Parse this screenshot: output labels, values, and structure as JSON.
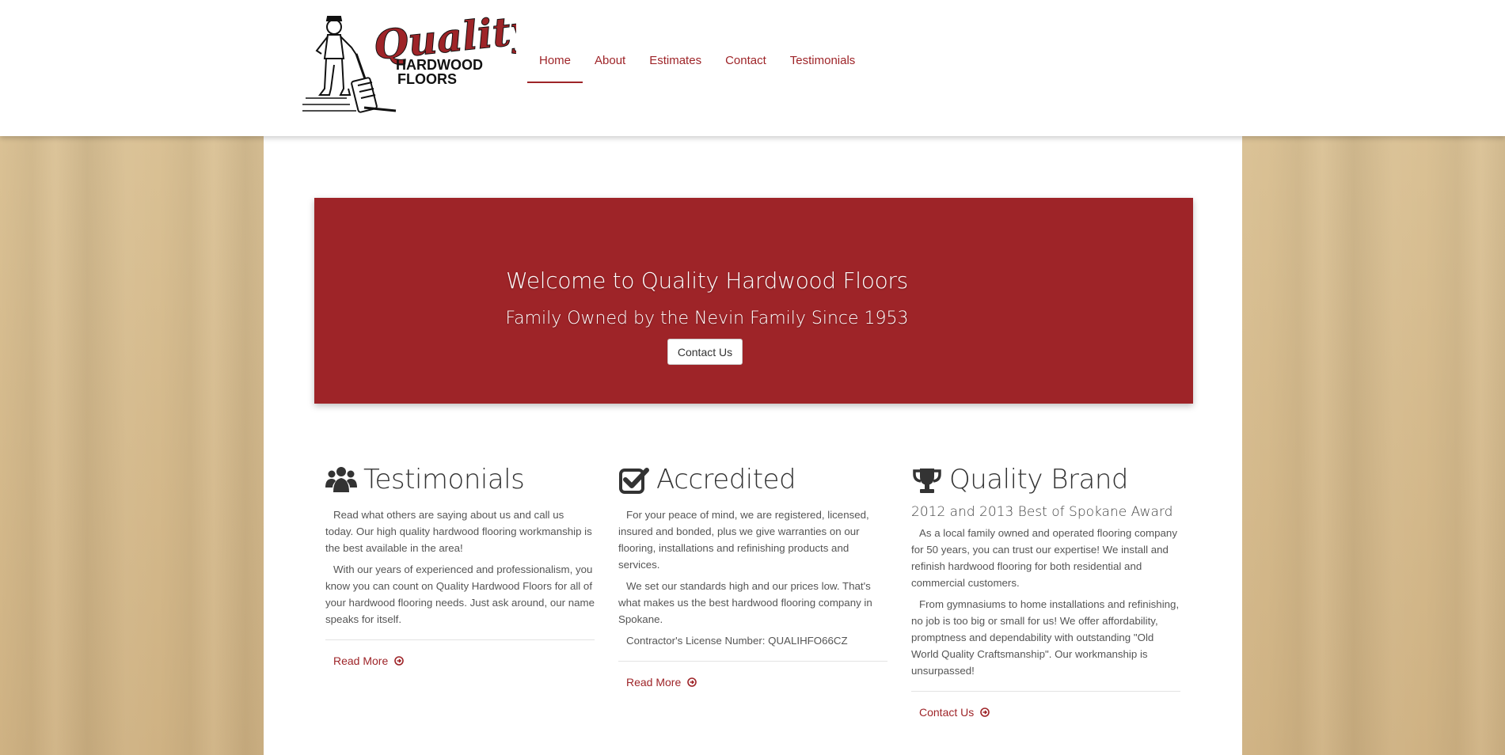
{
  "colors": {
    "brand_red": "#9e2428",
    "header_bg": "#ffffff",
    "wood_bg": "#d8bf92",
    "text": "#555555",
    "heading": "#333333"
  },
  "logo": {
    "word_quality": "Quality",
    "word_hardwood": "HARDWOOD",
    "word_floors": "FLOORS"
  },
  "nav": {
    "items": [
      {
        "label": "Home",
        "active": true
      },
      {
        "label": "About",
        "active": false
      },
      {
        "label": "Estimates",
        "active": false
      },
      {
        "label": "Contact",
        "active": false
      },
      {
        "label": "Testimonials",
        "active": false
      }
    ]
  },
  "hero": {
    "title": "Welcome to Quality Hardwood Floors",
    "subtitle": "Family Owned by the Nevin Family Since 1953",
    "button_label": "Contact Us"
  },
  "columns": [
    {
      "icon": "users-icon",
      "title": "Testimonials",
      "subtitle": "",
      "paragraphs": [
        "Read what others are saying about us and call us today. Our high quality hardwood flooring workmanship is the best available in the area!",
        "With our years of experienced and professionalism, you know you can count on Quality Hardwood Floors for all of your hardwood flooring needs. Just ask around, our name speaks for itself."
      ],
      "link_label": "Read More"
    },
    {
      "icon": "check-square-icon",
      "title": "Accredited",
      "subtitle": "",
      "paragraphs": [
        "For your peace of mind, we are registered, licensed, insured and bonded, plus we give warranties on our flooring, installations and refinishing products and services.",
        "We set our standards high and our prices low. That's what makes us the best hardwood flooring company in Spokane.",
        "Contractor's License Number: QUALIHFO66CZ"
      ],
      "link_label": "Read More"
    },
    {
      "icon": "trophy-icon",
      "title": "Quality Brand",
      "subtitle": "2012 and 2013 Best of Spokane Award",
      "paragraphs": [
        "As a local family owned and operated flooring company for 50 years, you can trust our expertise! We install and refinish hardwood flooring for both residential and commercial customers.",
        "From gymnasiums to home installations and refinishing, no job is too big or small for us! We offer affordability, promptness and dependability with outstanding \"Old World Quality Craftsmanship\". Our workmanship is unsurpassed!"
      ],
      "link_label": "Contact Us"
    }
  ]
}
